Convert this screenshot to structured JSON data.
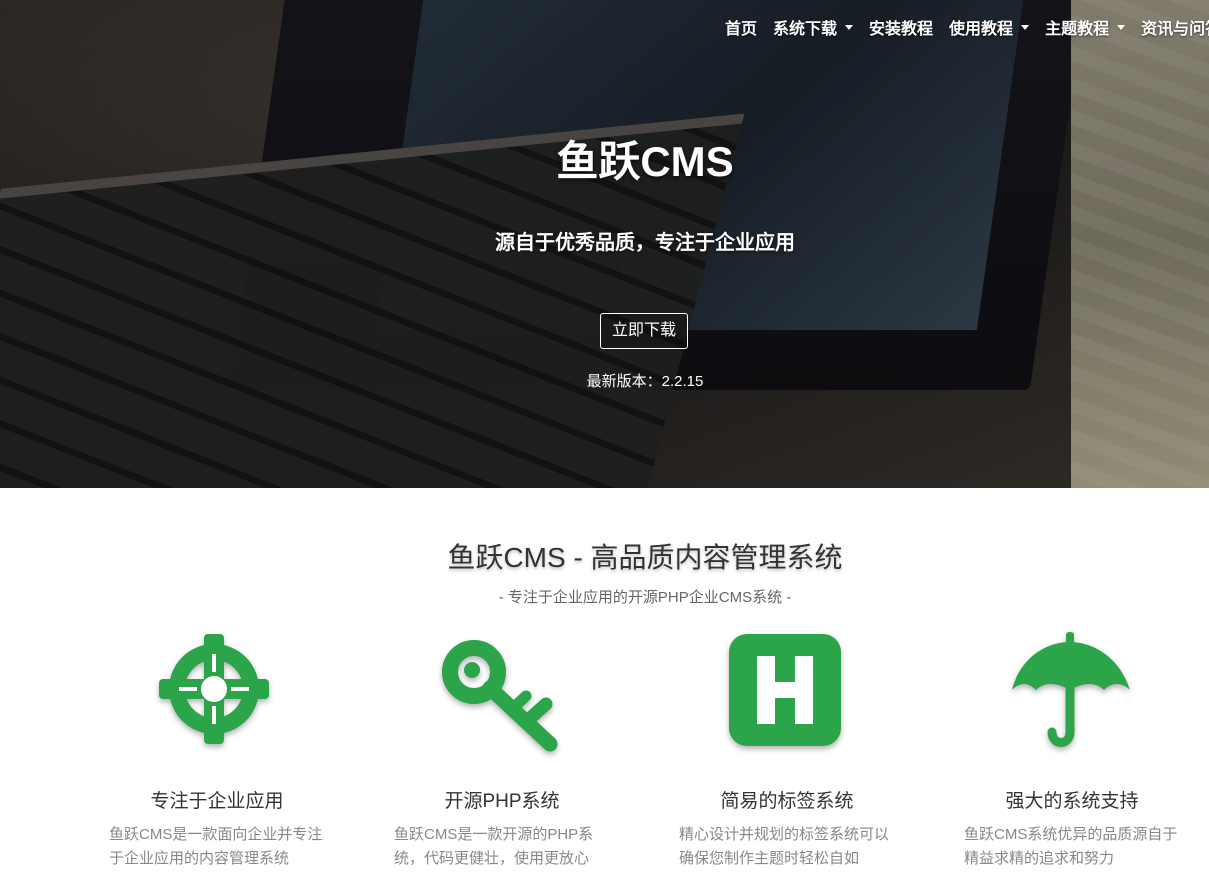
{
  "nav": {
    "items": [
      {
        "label": "首页",
        "dropdown": false
      },
      {
        "label": "系统下载",
        "dropdown": true
      },
      {
        "label": "安装教程",
        "dropdown": false
      },
      {
        "label": "使用教程",
        "dropdown": true
      },
      {
        "label": "主题教程",
        "dropdown": true
      },
      {
        "label": "资讯与问答",
        "dropdown": false
      }
    ]
  },
  "hero": {
    "title": "鱼跃CMS",
    "subtitle": "源自于优秀品质，专注于企业应用",
    "download_label": "立即下载",
    "version_text": "最新版本：2.2.15"
  },
  "intro": {
    "title": "鱼跃CMS - 高品质内容管理系统",
    "subtitle": "- 专注于企业应用的开源PHP企业CMS系统 -"
  },
  "features": [
    {
      "icon": "crosshair-icon",
      "title": "专注于企业应用",
      "desc": "鱼跃CMS是一款面向企业并专注于企业应用的内容管理系统"
    },
    {
      "icon": "key-icon",
      "title": "开源PHP系统",
      "desc": "鱼跃CMS是一款开源的PHP系统，代码更健壮，使用更放心"
    },
    {
      "icon": "h-square-icon",
      "title": "简易的标签系统",
      "desc": "精心设计并规划的标签系统可以确保您制作主题时轻松自如"
    },
    {
      "icon": "umbrella-icon",
      "title": "强大的系统支持",
      "desc": "鱼跃CMS系统优异的品质源自于精益求精的追求和努力"
    }
  ],
  "colors": {
    "accent": "#2ca44a",
    "text": "#333333",
    "muted": "#888888"
  }
}
